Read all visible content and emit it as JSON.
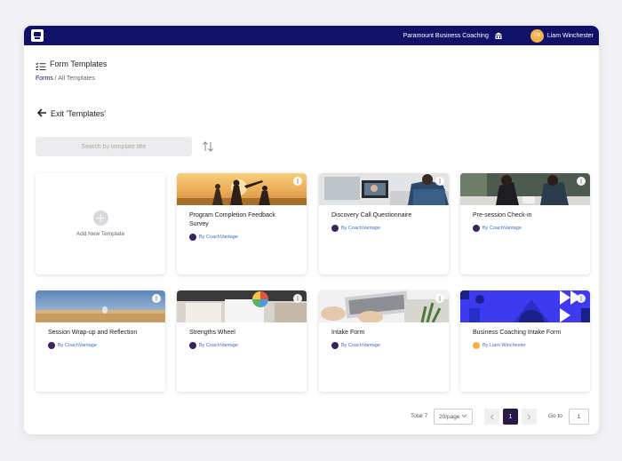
{
  "topbar": {
    "org_name": "Paramount Business Coaching",
    "user_initials": "LW",
    "user_name": "Liam Winchester"
  },
  "page": {
    "title": "Form Templates",
    "breadcrumb_link": "Forms",
    "breadcrumb_sep": " / ",
    "breadcrumb_current": "All Templates",
    "exit_label": "Exit 'Templates'"
  },
  "search": {
    "placeholder": "Search by template title",
    "value": ""
  },
  "add_card": {
    "label": "Add New Template"
  },
  "templates": [
    {
      "title": "Program Completion Feedback Survey",
      "author": "By CoachVantage"
    },
    {
      "title": "Discovery Call Questionnaire",
      "author": "By CoachVantage"
    },
    {
      "title": "Pre-session Check-in",
      "author": "By CoachVantage"
    },
    {
      "title": "Session Wrap-up and Reflection",
      "author": "By CoachVantage"
    },
    {
      "title": "Strengths Wheel",
      "author": "By CoachVantage"
    },
    {
      "title": "Intake Form",
      "author": "By CoachVantage"
    },
    {
      "title": "Business Coaching Intake Form",
      "author": "By Liam Winchester"
    }
  ],
  "pagination": {
    "total_label": "Total 7",
    "page_size": "20/page",
    "current_page": "1",
    "goto_label": "Go to",
    "goto_value": "1"
  },
  "colors": {
    "brand": "#11116a",
    "accent": "#2a1848",
    "link": "#3b6fc4",
    "avatar": "#f5b14a"
  }
}
